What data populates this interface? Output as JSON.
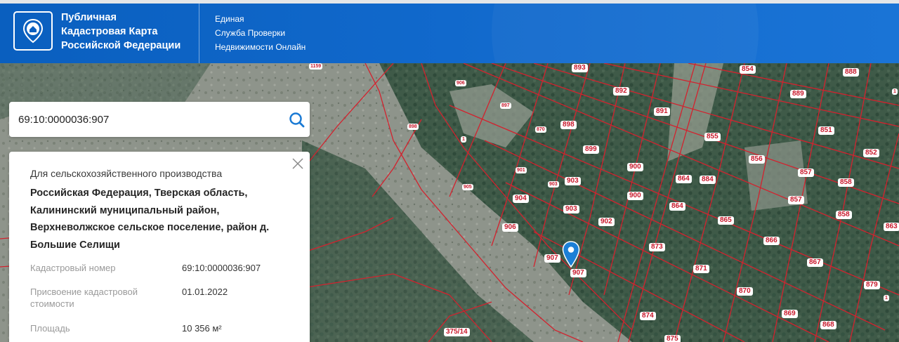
{
  "header": {
    "title_lines": [
      "Публичная",
      "Кадастровая Карта",
      "Российской Федерации"
    ],
    "service_lines": [
      "Единая",
      "Служба Проверки",
      "Недвижимости Онлайн"
    ],
    "logo_icon": "house-pin-icon"
  },
  "search": {
    "value": "69:10:0000036:907",
    "icon": "search-icon"
  },
  "card": {
    "purpose": "Для сельскохозяйственного производства",
    "address_lines": [
      "Российская Федерация, Тверская область,",
      "Калининский муниципальный район,",
      "Верхневолжское сельское поселение, район д.",
      "Большие Селищи"
    ],
    "properties": [
      {
        "label": "Кадастровый номер",
        "value": "69:10:0000036:907"
      },
      {
        "label": "Присвоение кадастровой стоимости",
        "value": "01.01.2022"
      },
      {
        "label": "Площадь",
        "value": "10 356 м²"
      }
    ],
    "close_icon": "close-icon"
  },
  "map": {
    "marker_icon": "map-pin-icon",
    "boundary_color": "#d3222e",
    "plot_labels": [
      "893",
      "854",
      "888",
      "892",
      "889",
      "891",
      "898",
      "855",
      "851",
      "899",
      "856",
      "852",
      "900",
      "864",
      "884",
      "857",
      "858",
      "904",
      "903",
      "903",
      "900",
      "864",
      "857",
      "902",
      "865",
      "858",
      "863",
      "906",
      "873",
      "866",
      "907",
      "907",
      "871",
      "867",
      "870",
      "879",
      "874",
      "869",
      "868",
      "875",
      "375/14"
    ],
    "small_labels": [
      "1159",
      "906",
      "897",
      "870",
      "901",
      "903",
      "898",
      "905",
      "1",
      "1",
      "1"
    ]
  },
  "colors": {
    "header_blue": "#0a5fbf",
    "pin_blue": "#1c7fd6"
  }
}
